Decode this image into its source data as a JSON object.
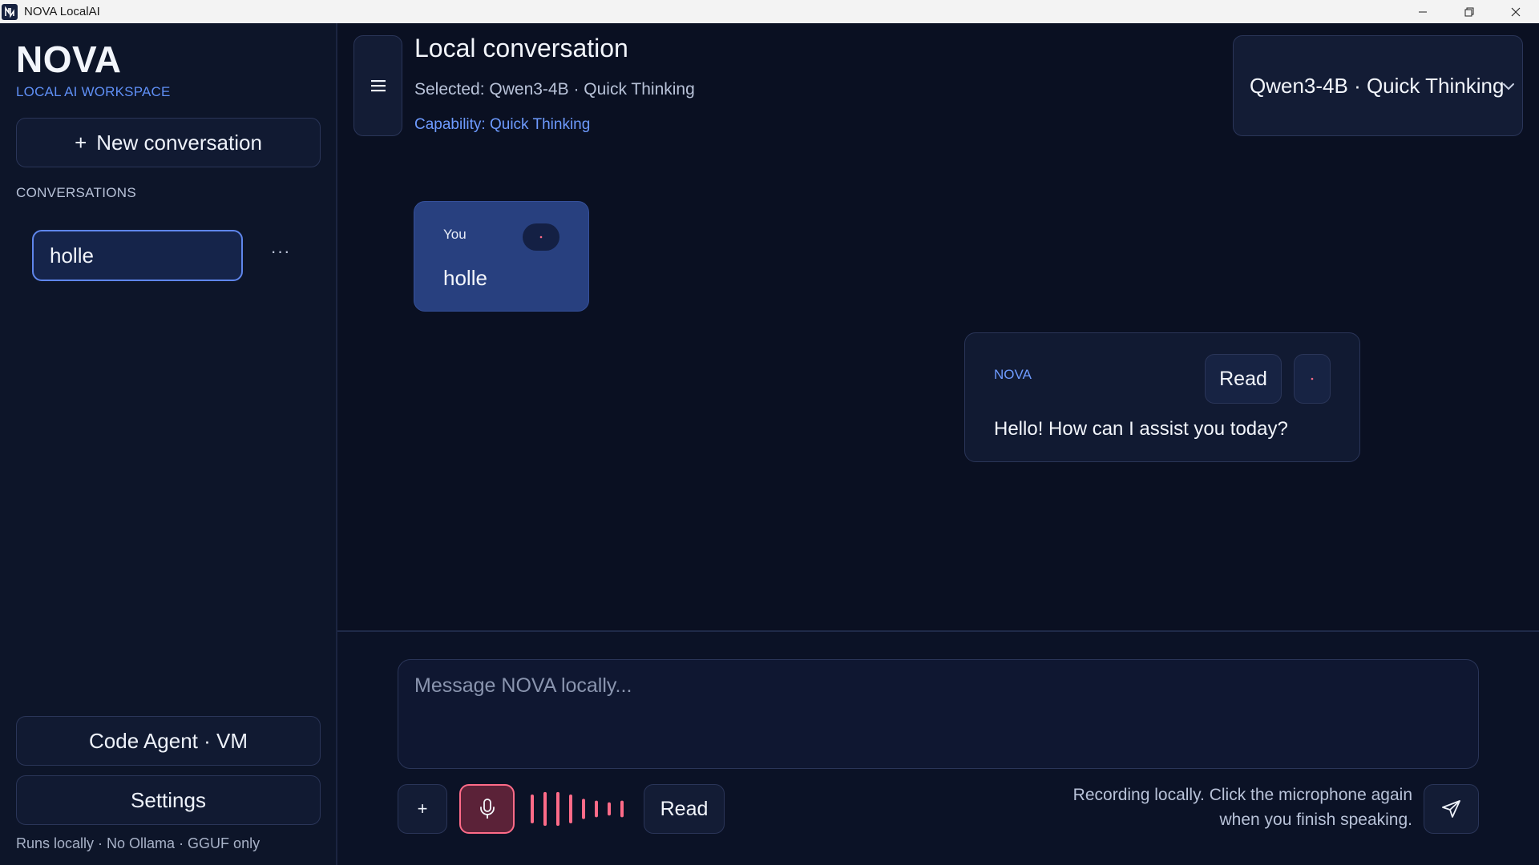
{
  "window": {
    "title": "NOVA LocalAI",
    "controls": [
      "minimize-icon",
      "restore-icon",
      "close-icon"
    ]
  },
  "sidebar": {
    "brand": "NOVA",
    "brand_subtitle": "LOCAL AI WORKSPACE",
    "new_conversation_label": "New conversation",
    "new_conversation_icon": "+",
    "conversations_heading": "CONVERSATIONS",
    "conversations": [
      {
        "title": "holle",
        "active": true,
        "more_label": "···"
      }
    ],
    "code_agent_label": "Code Agent · VM",
    "settings_label": "Settings",
    "footer_note": "Runs locally · No Ollama · GGUF only"
  },
  "header": {
    "title": "Local conversation",
    "selected_text": "Selected: Qwen3-4B · Quick Thinking",
    "capability_text": "Capability: Quick Thinking",
    "model_select_value": "Qwen3-4B · Quick Thinking"
  },
  "messages": [
    {
      "role": "user",
      "author": "You",
      "text": "holle"
    },
    {
      "role": "assistant",
      "author": "NOVA",
      "text": "Hello! How can I assist you today?",
      "read_label": "Read"
    }
  ],
  "composer": {
    "placeholder": "Message NOVA locally...",
    "value": "",
    "attach_label": "+",
    "read_label": "Read",
    "recording_status_line1": "Recording locally. Click the microphone again",
    "recording_status_line2": "when you finish speaking.",
    "level_bars": [
      0.78,
      0.92,
      0.92,
      0.78,
      0.55,
      0.45,
      0.36,
      0.45
    ]
  },
  "colors": {
    "background": "#0a1022",
    "sidebar": "#0d1529",
    "accent": "#5f86ec",
    "accent_text": "#6e9bff",
    "user_bubble": "#28407f",
    "recording": "#ff6b88"
  }
}
